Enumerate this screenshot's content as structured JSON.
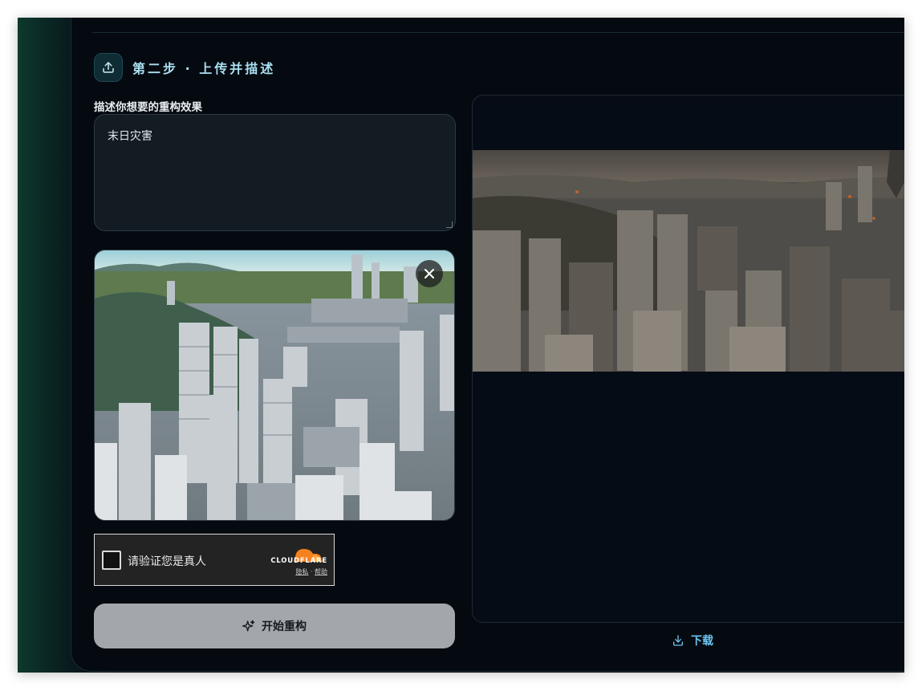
{
  "step": {
    "title": "第二步 · 上传并描述",
    "icon": "upload-icon"
  },
  "prompt": {
    "label": "描述你想要的重构效果",
    "value": "末日灾害"
  },
  "upload": {
    "remove_icon": "close-icon"
  },
  "captcha": {
    "text": "请验证您是真人",
    "brand": "CLOUDFLARE",
    "privacy": "隐私",
    "separator": "·",
    "help": "帮助"
  },
  "actions": {
    "start_label": "开始重构",
    "start_icon": "sparkles-icon",
    "download_label": "下载",
    "download_icon": "download-icon"
  },
  "colors": {
    "accent": "#6cc4f2",
    "title": "#a9dff0",
    "button_disabled": "#a3a6aa",
    "cloudflare_orange": "#f6821f"
  }
}
